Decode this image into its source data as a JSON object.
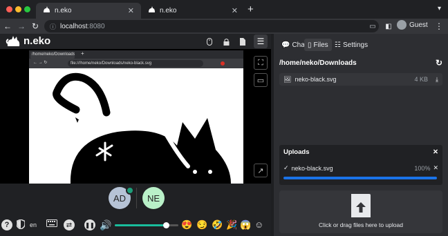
{
  "browser": {
    "tabs": [
      {
        "title": "n.eko",
        "close": "✕"
      },
      {
        "title": "n.eko",
        "close": "✕"
      }
    ],
    "new_tab_icon": "+",
    "window_menu_icon": "chevron-down-icon",
    "address": {
      "host": "localhost",
      "port": ":8080"
    },
    "profile_label": "Guest"
  },
  "app": {
    "logo_text": "n.eko",
    "header_icons": [
      "mouse-icon",
      "lock-icon",
      "document-icon"
    ],
    "menu_icon": "hamburger-icon",
    "video": {
      "inner_tab_title": "/home/neko/Downloads/neko-black.svg",
      "inner_address": "file:///home/neko/Downloads/neko-black.svg"
    },
    "side_tools": [
      "fullscreen-icon",
      "screen-icon",
      "external-link-icon"
    ],
    "members": [
      {
        "initials": "AD",
        "color": "#b6c3d6",
        "badge": true
      },
      {
        "initials": "NE",
        "color": "#b9f0c8",
        "badge": false
      }
    ],
    "controls": {
      "help_icon": "?",
      "language": "en",
      "volume_level": 0.8,
      "emojis": [
        "😍",
        "😏",
        "🤣",
        "🎉",
        "😱",
        "☺"
      ]
    }
  },
  "sidebar": {
    "tabs": [
      {
        "label": "Chat",
        "icon": "chat-icon"
      },
      {
        "label": "Files",
        "icon": "files-icon"
      },
      {
        "label": "Settings",
        "icon": "sliders-icon"
      }
    ],
    "active_tab": "Files",
    "path": "/home/neko/Downloads",
    "refresh_icon": "refresh-icon",
    "files": [
      {
        "name": "neko-black.svg",
        "size": "4 KB"
      }
    ],
    "uploads": {
      "title": "Uploads",
      "close": "✕",
      "items": [
        {
          "name": "neko-black.svg",
          "progress_text": "100%",
          "progress": 1.0
        }
      ]
    },
    "dropzone_text": "Click or drag files here to upload"
  },
  "colors": {
    "accent": "#1a73e8",
    "sidebar_bg": "#2d2e32"
  }
}
